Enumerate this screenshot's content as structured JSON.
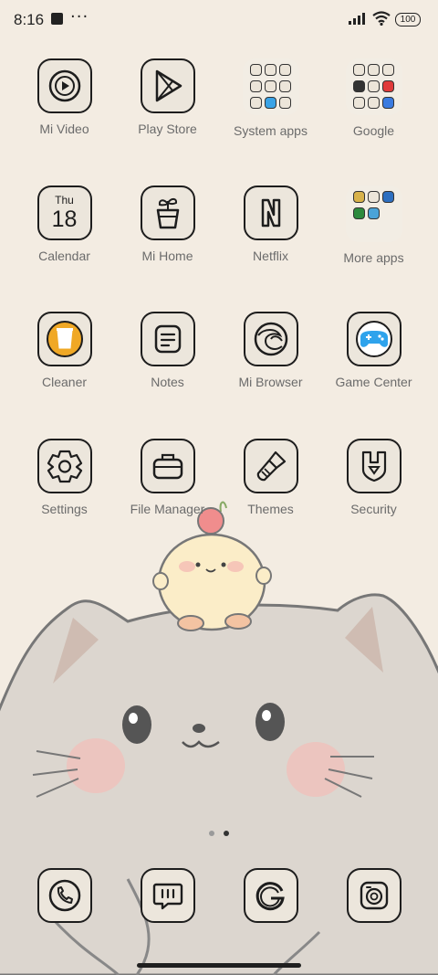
{
  "status_bar": {
    "time": "8:16",
    "notification_icon": "notification-square-icon",
    "more_glyph": "···",
    "battery": "100"
  },
  "home": {
    "apps": [
      {
        "label": "Mi Video",
        "icon": "play-circle-icon"
      },
      {
        "label": "Play Store",
        "icon": "play-store-icon"
      },
      {
        "label": "System apps",
        "icon": "folder-icon"
      },
      {
        "label": "Google",
        "icon": "folder-icon"
      },
      {
        "label": "Calendar",
        "icon": "calendar-icon",
        "day": "Thu",
        "date": "18"
      },
      {
        "label": "Mi Home",
        "icon": "plant-pot-icon"
      },
      {
        "label": "Netflix",
        "icon": "netflix-n-icon"
      },
      {
        "label": "More apps",
        "icon": "folder-icon"
      },
      {
        "label": "Cleaner",
        "icon": "trash-bin-icon"
      },
      {
        "label": "Notes",
        "icon": "note-lines-icon"
      },
      {
        "label": "Mi Browser",
        "icon": "browser-swirl-icon"
      },
      {
        "label": "Game Center",
        "icon": "gamepad-icon"
      },
      {
        "label": "Settings",
        "icon": "gear-icon"
      },
      {
        "label": "File Manager",
        "icon": "briefcase-icon"
      },
      {
        "label": "Themes",
        "icon": "paintbrush-icon"
      },
      {
        "label": "Security",
        "icon": "shield-icon"
      }
    ],
    "page_indicator": {
      "pages": 2,
      "current": 2
    }
  },
  "dock": {
    "apps": [
      {
        "name": "Phone",
        "icon": "phone-icon"
      },
      {
        "name": "Messaging",
        "icon": "message-icon"
      },
      {
        "name": "Google Search",
        "icon": "google-g-icon"
      },
      {
        "name": "Camera",
        "icon": "camera-icon"
      }
    ]
  },
  "colors": {
    "background": "#f3ece2",
    "icon_fill": "#ece6dc",
    "icon_stroke": "#1d1d1d",
    "label": "#6b6b6b",
    "cat_body": "#dcd6cf",
    "chick": "#fbedc8",
    "cheek": "#f3c3b8"
  }
}
